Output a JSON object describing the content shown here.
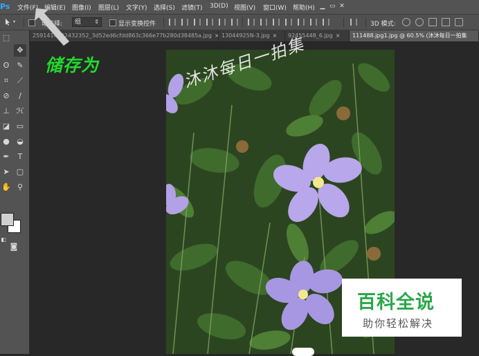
{
  "app": {
    "logo": "Ps"
  },
  "menu": [
    "文件(F)",
    "编辑(E)",
    "图像(I)",
    "图层(L)",
    "文字(Y)",
    "选择(S)",
    "滤镜(T)",
    "3D(D)",
    "视图(V)",
    "窗口(W)",
    "帮助(H)"
  ],
  "window_controls": {
    "minimize": "▁",
    "maximize": "▭",
    "close": "✕"
  },
  "options": {
    "auto_select_label": "动选择:",
    "auto_select_value": "组",
    "show_transform_label": "显示变换控件",
    "mode_3d_label": "3D 模式:"
  },
  "tabs": [
    {
      "label": "2591414602432352_3d52ed6cfdd863c366e77b280d38485a.jpg",
      "close": "×"
    },
    {
      "label": "13044925N-3.jpg",
      "close": "×"
    },
    {
      "label": "92455448_6.jpg",
      "close": "×"
    },
    {
      "label": "111488.jpg1.jpg @ 60.5% (沐沐每日一拍集",
      "close": ""
    }
  ],
  "annotation": {
    "text": "储存为",
    "color": "#22d92c"
  },
  "photo": {
    "watermark": "沐沐每日一拍集"
  },
  "site_logo": {
    "title": "百科全说",
    "subtitle": "助你轻松解决",
    "color": "#2aa74a"
  },
  "colors": {
    "accent": "#31a8ff",
    "arrow": "#cfcfcf"
  }
}
